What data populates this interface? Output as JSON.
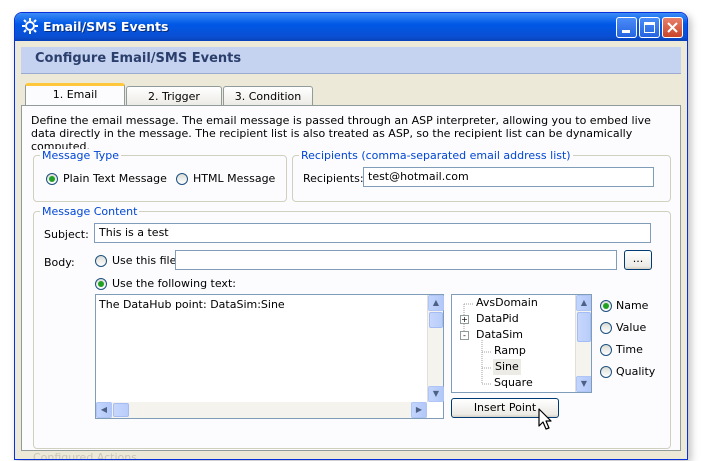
{
  "window": {
    "title": "Email/SMS Events"
  },
  "header": {
    "title": "Configure Email/SMS Events"
  },
  "tabs": [
    {
      "label": "1. Email",
      "active": true
    },
    {
      "label": "2. Trigger",
      "active": false
    },
    {
      "label": "3. Condition",
      "active": false
    }
  ],
  "description": "Define the email message.  The email message is passed through an ASP interpreter, allowing you to embed live data directly in the message.  The recipient list is also treated as ASP, so the recipient list can be dynamically computed.",
  "message_type": {
    "legend": "Message Type",
    "options": [
      {
        "label": "Plain Text Message",
        "selected": true
      },
      {
        "label": "HTML Message",
        "selected": false
      }
    ]
  },
  "recipients": {
    "legend": "Recipients (comma-separated email address list)",
    "label": "Recipients:",
    "value": "test@hotmail.com"
  },
  "content": {
    "legend": "Message Content",
    "subject_label": "Subject:",
    "subject_value": "This is a test",
    "body_label": "Body:",
    "use_file_label": "Use this file:",
    "file_value": "",
    "browse_label": "...",
    "use_text_label": "Use the following text:",
    "body_text": "The DataHub point: DataSim:Sine",
    "insert_label": "Insert Point"
  },
  "tree": [
    {
      "label": "AvsDomain",
      "expander": "",
      "indent": 0
    },
    {
      "label": "DataPid",
      "expander": "+",
      "indent": 0
    },
    {
      "label": "DataSim",
      "expander": "-",
      "indent": 0
    },
    {
      "label": "Ramp",
      "expander": "",
      "indent": 1
    },
    {
      "label": "Sine",
      "expander": "",
      "indent": 1,
      "selected": true
    },
    {
      "label": "Square",
      "expander": "",
      "indent": 1
    }
  ],
  "point_options": [
    {
      "label": "Name",
      "selected": true
    },
    {
      "label": "Value",
      "selected": false
    },
    {
      "label": "Time",
      "selected": false
    },
    {
      "label": "Quality",
      "selected": false
    }
  ],
  "footer_partial": "Configured Actions",
  "colors": {
    "titlebar": "#0058e6",
    "legend": "#0046d5",
    "tab_highlight": "#ffc83c",
    "header_band": "#c5d3f0"
  }
}
